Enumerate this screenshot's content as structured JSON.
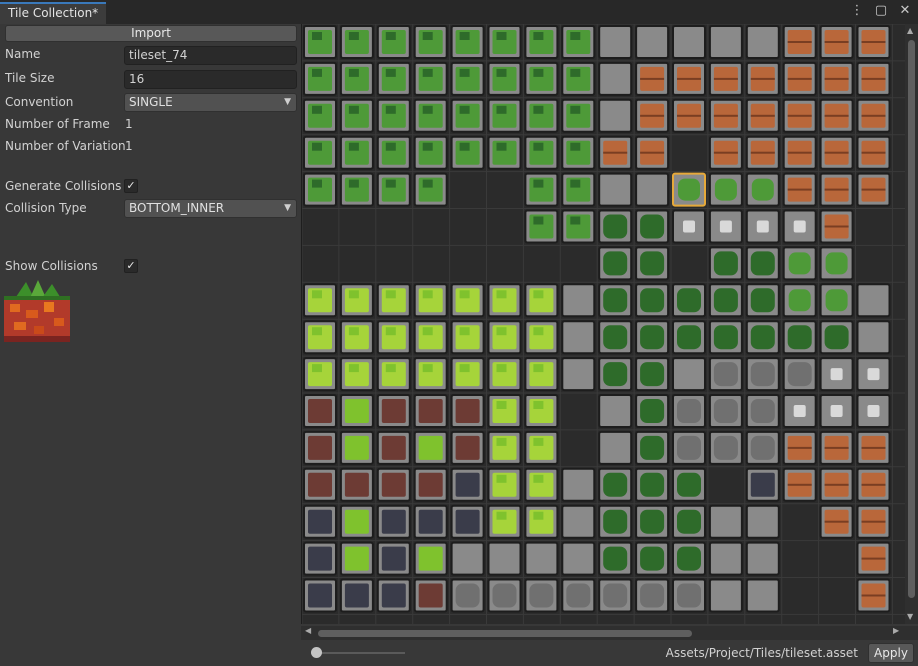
{
  "window": {
    "tab_title": "Tile Collection*",
    "icons": [
      "more-vert-icon",
      "maximize-icon",
      "close-icon"
    ]
  },
  "inspector": {
    "import_label": "Import",
    "fields": {
      "name_label": "Name",
      "name_value": "tileset_74",
      "tile_size_label": "Tile Size",
      "tile_size_value": "16",
      "convention_label": "Convention",
      "convention_value": "SINGLE",
      "frames_label": "Number of Frame",
      "frames_value": "1",
      "variations_label": "Number of Variation",
      "variations_value": "1",
      "gen_collisions_label": "Generate Collisions",
      "gen_collisions_checked": true,
      "collision_type_label": "Collision Type",
      "collision_type_value": "BOTTOM_INNER",
      "show_collisions_label": "Show Collisions",
      "show_collisions_checked": true
    },
    "check_glyph": "✓",
    "dropdown_arrow": "▼"
  },
  "grid": {
    "columns": 16,
    "rows": 16,
    "selected_tile": {
      "row": 4,
      "col": 10
    },
    "colors": {
      "background": "#2b2b2b",
      "tile_fill": "#8a8a8a",
      "tile_border": "#1d1d1d",
      "selected_border": "#e6a93a",
      "leaf_dark": "#2e6b2a",
      "leaf_mid": "#4e9a38",
      "grass_light": "#a6d43a",
      "grass_bright": "#7fc22d",
      "wood": "#b9673a",
      "rock": "#707070",
      "dirt": "#6d3b34",
      "stone_dark": "#3a3c4a"
    }
  },
  "scroll": {
    "left_arrow": "◀",
    "right_arrow": "▶",
    "up_arrow": "▲",
    "down_arrow": "▼"
  },
  "footer": {
    "asset_path": "Assets/Project/Tiles/tileset.asset",
    "apply_label": "Apply"
  }
}
